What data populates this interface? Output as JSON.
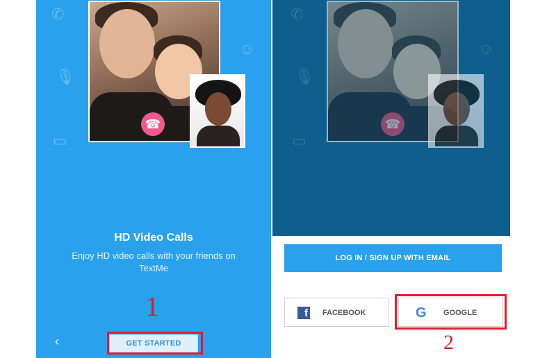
{
  "colors": {
    "brand_blue": "#2aa1ec",
    "dim_overlay": "#0f5f8c",
    "end_call_pink": "#ef5a8e",
    "annotation_red": "#e21b2b",
    "facebook_blue": "#3b5998"
  },
  "onboarding": {
    "title": "HD Video Calls",
    "description": "Enjoy HD video calls with your friends on TextMe",
    "get_started_label": "GET STARTED",
    "back_icon": "chevron-left-icon",
    "end_call_icon": "phone-hangup-icon"
  },
  "login_sheet": {
    "email_label": "LOG IN / SIGN UP WITH EMAIL",
    "facebook_label": "FACEBOOK",
    "google_label": "GOOGLE",
    "facebook_icon": "facebook-icon",
    "google_icon": "google-icon"
  },
  "annotations": {
    "step1": "1",
    "step2": "2"
  },
  "glyphs": {
    "phone": "✆",
    "mic": "🎙",
    "video": "▭",
    "smiley": "☺",
    "chevron": "‹",
    "hangup": "☎",
    "facebook": "f",
    "google": "G"
  }
}
